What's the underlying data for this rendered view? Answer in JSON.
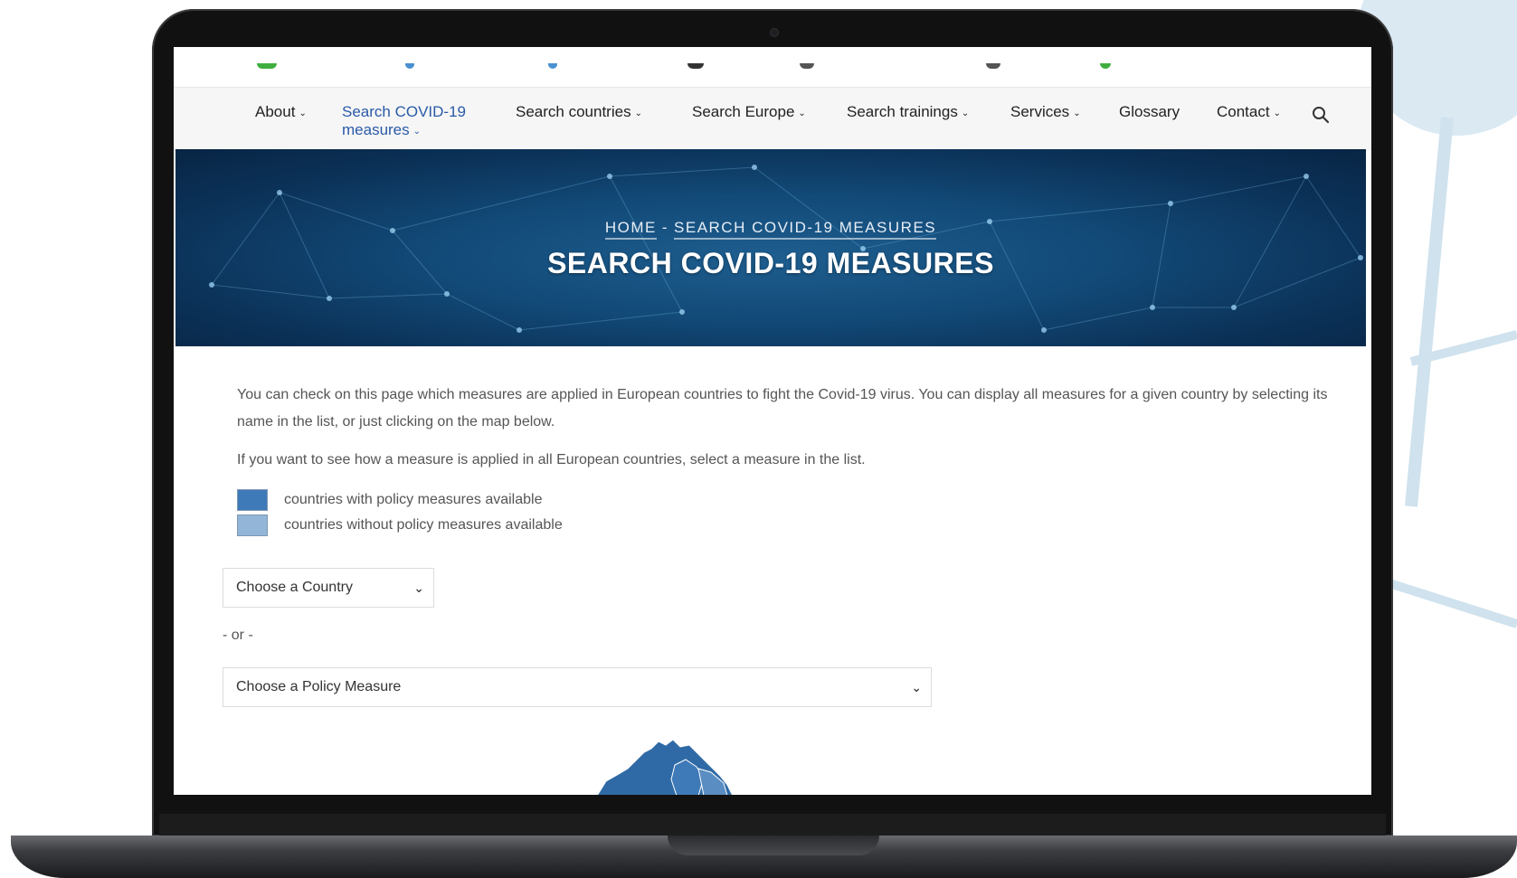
{
  "nav": {
    "items": [
      {
        "label": "About",
        "has_dropdown": true
      },
      {
        "label": "Search COVID-19",
        "label_line2": "measures",
        "has_dropdown": true,
        "active": true
      },
      {
        "label": "Search countries",
        "has_dropdown": true
      },
      {
        "label": "Search Europe",
        "has_dropdown": true
      },
      {
        "label": "Search trainings",
        "has_dropdown": true
      },
      {
        "label": "Services",
        "has_dropdown": true
      },
      {
        "label": "Glossary",
        "has_dropdown": false
      },
      {
        "label": "Contact",
        "has_dropdown": true
      }
    ],
    "search_icon": "search-icon"
  },
  "hero": {
    "breadcrumb_home": "HOME",
    "breadcrumb_separator": "-",
    "breadcrumb_current": "SEARCH COVID-19 MEASURES",
    "title": "SEARCH COVID-19 MEASURES"
  },
  "content": {
    "intro": "You can check on this page which measures are applied in European countries to fight the Covid-19 virus. You can display all measures for a given country by selecting its name in the list, or just clicking on the map below.",
    "intro_measure": "If you want to see how a measure is applied in all European countries, select a measure in the list.",
    "legend": [
      {
        "label": "countries with policy measures available",
        "color": "#3f7ab8"
      },
      {
        "label": "countries without policy measures available",
        "color": "#93b6d8"
      }
    ],
    "country_select": "Choose a Country",
    "or_text": "- or -",
    "measure_select": "Choose a Policy Measure"
  },
  "colors": {
    "accent": "#2a5aa8",
    "nav_background": "#f6f6f6",
    "hero_background": "#0b3157",
    "map_fill": "#2f6aa6"
  }
}
